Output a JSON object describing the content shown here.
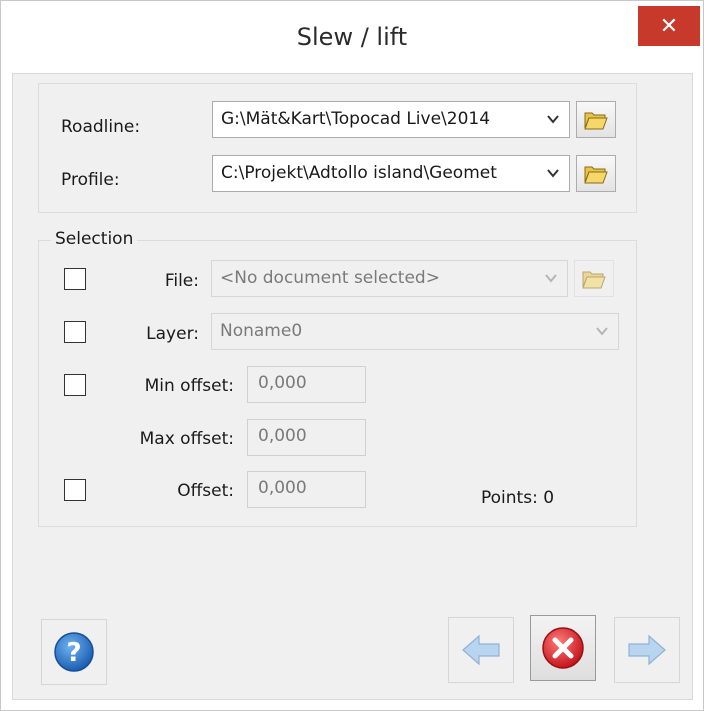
{
  "window": {
    "title": "Slew / lift",
    "close_glyph": "✕"
  },
  "source": {
    "roadline_label": "Roadline:",
    "roadline_value": "G:\\Mät&Kart\\Topocad Live\\2014",
    "profile_label": "Profile:",
    "profile_value": "C:\\Projekt\\Adtollo island\\Geomet"
  },
  "selection": {
    "title": "Selection",
    "file_label": "File:",
    "file_value": "<No document selected>",
    "layer_label": "Layer:",
    "layer_value": "Noname0",
    "min_offset_label": "Min offset:",
    "min_offset_value": "0,000",
    "max_offset_label": "Max offset:",
    "max_offset_value": "0,000",
    "offset_label": "Offset:",
    "offset_value": "0,000",
    "points_text": "Points: 0"
  },
  "colors": {
    "accent": "#3b82c4",
    "close": "#c7392a",
    "cancel": "#d9363e"
  }
}
